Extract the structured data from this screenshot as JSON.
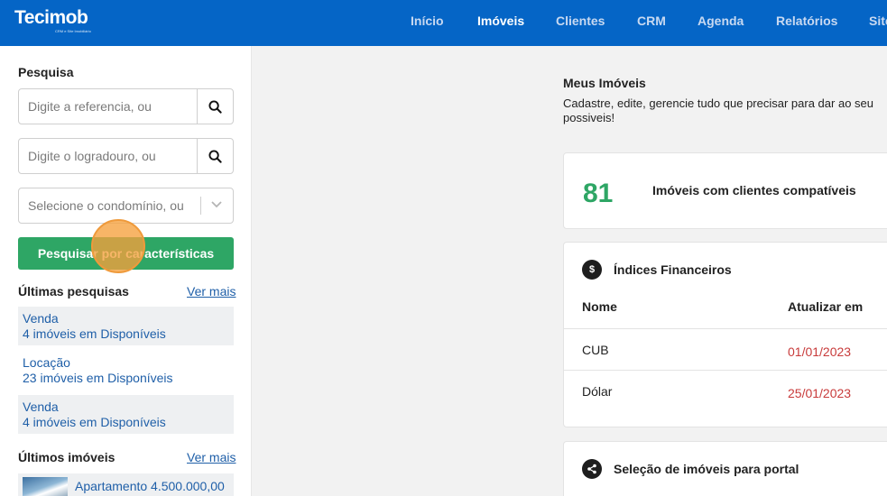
{
  "app": {
    "logo_left": "Tec",
    "logo_right": "imob",
    "logo_tagline": "CRM e Site Imobiliário"
  },
  "nav": {
    "items": [
      "Início",
      "Imóveis",
      "Clientes",
      "CRM",
      "Agenda",
      "Relatórios",
      "Site"
    ],
    "active": "Imóveis"
  },
  "sidebar": {
    "search_title": "Pesquisa",
    "reference_placeholder": "Digite a referencia, ou",
    "street_placeholder": "Digite o logradouro, ou",
    "condo_placeholder": "Selecione o condomínio, ou",
    "features_button": "Pesquisar por características",
    "recent_searches_title": "Últimas pesquisas",
    "see_more_label": "Ver mais",
    "recent_searches": [
      {
        "type": "Venda",
        "detail": "4 imóveis em Disponíveis"
      },
      {
        "type": "Locação",
        "detail": "23 imóveis em Disponíveis"
      },
      {
        "type": "Venda",
        "detail": "4 imóveis em Disponíveis"
      }
    ],
    "recent_properties_title": "Últimos imóveis",
    "recent_properties": [
      {
        "label": "Apartamento 4.500.000,00"
      }
    ]
  },
  "main": {
    "title": "Meus Imóveis",
    "description": "Cadastre, edite, gerencie tudo que precisar para dar ao seu possiveis!",
    "matches": {
      "count": "81",
      "label": "Imóveis com clientes compatíveis"
    },
    "financial": {
      "title": "Índices Financeiros",
      "icon_glyph": "$",
      "columns": [
        "Nome",
        "Atualizar em"
      ],
      "rows": [
        {
          "name": "CUB",
          "date": "01/01/2023"
        },
        {
          "name": "Dólar",
          "date": "25/01/2023"
        }
      ]
    },
    "portal": {
      "title": "Seleção de imóveis para portal"
    }
  },
  "colors": {
    "topbar": "#0565c6",
    "accent_green": "#2ea665",
    "link_blue": "#1f5fa8",
    "date_red": "#c83b3b",
    "cursor_orange": "#ef9a3b"
  },
  "icons": {
    "search": "search-icon",
    "chevron": "chevron-down-icon",
    "dollar": "dollar-icon",
    "share": "share-icon"
  }
}
